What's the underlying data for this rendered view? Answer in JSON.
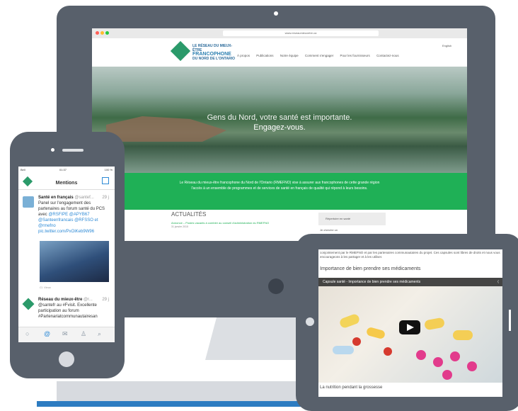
{
  "monitor": {
    "browser": {
      "url": "www.reseaumieuxetre.ca"
    },
    "site": {
      "logo_lines": [
        "LE RÉSEAU DU MIEUX-ÊTRE",
        "FRANCOPHONE",
        "DU NORD DE L'ONTARIO"
      ],
      "nav": [
        "À propos",
        "Publications",
        "Notre équipe",
        "Comment s'engager",
        "Pour les fournisseurs",
        "Contactez-nous"
      ],
      "lang": "English",
      "hero_line1": "Gens du Nord, votre santé est importante.",
      "hero_line2": "Engagez-vous.",
      "mission": "Le Réseau du mieux-être francophone du Nord de l'Ontario (RMEFNO) vise à assurer aux francophones de cette grande région l'accès à un ensemble de programmes et de services de santé en français de qualité qui répond à leurs besoins.",
      "news_heading": "ACTUALITÉS",
      "news_item": "Annonce – Postes vacants à combler au conseil d'administration du RMEFNO",
      "news_date": "31 janvier 2015",
      "sidebar_box": "Répertoire en santé",
      "sidebar_link": "Je cherche un"
    }
  },
  "phone": {
    "status": {
      "carrier": "Bell",
      "time": "01:37",
      "battery": "100 %"
    },
    "title": "Mentions",
    "tweets": [
      {
        "author": "Santé en français",
        "handle": "@santef...",
        "time": "29 j",
        "text": "Panel sur l'engagement des partenaires au forum santé du PCS avec ",
        "links": "@RSFIPE @APYB67 @Santeenfrancais @RFSSO et @rmefno pic.twitter.com/PxOiKeb9W96",
        "location": "Cl. Vieux"
      },
      {
        "author": "Réseau du mieux-être",
        "handle": "@r...",
        "time": "29 j",
        "text": "@santefr au #Fvisit. Excellente participation au forum #Partenariatcommunautairesan"
      }
    ],
    "tabs": [
      "home-icon",
      "mentions-icon",
      "messages-icon",
      "profile-icon",
      "search-icon"
    ]
  },
  "tablet": {
    "intro": "conjointement par le RMEFNO et par les partenaires communautaires du projet. Ces capsules sont libres de droits et nous vous encourageons à les partager et à les utiliser.",
    "heading": "Importance de bien prendre ses médicaments",
    "video_title": "Capsule santé - Importance de bien prendre ses médicaments",
    "footer": "La nutrition pendant la grossesse"
  },
  "colors": {
    "device": "#58606b",
    "brand_green": "#1fb056",
    "link_blue": "#2d8ad6"
  }
}
